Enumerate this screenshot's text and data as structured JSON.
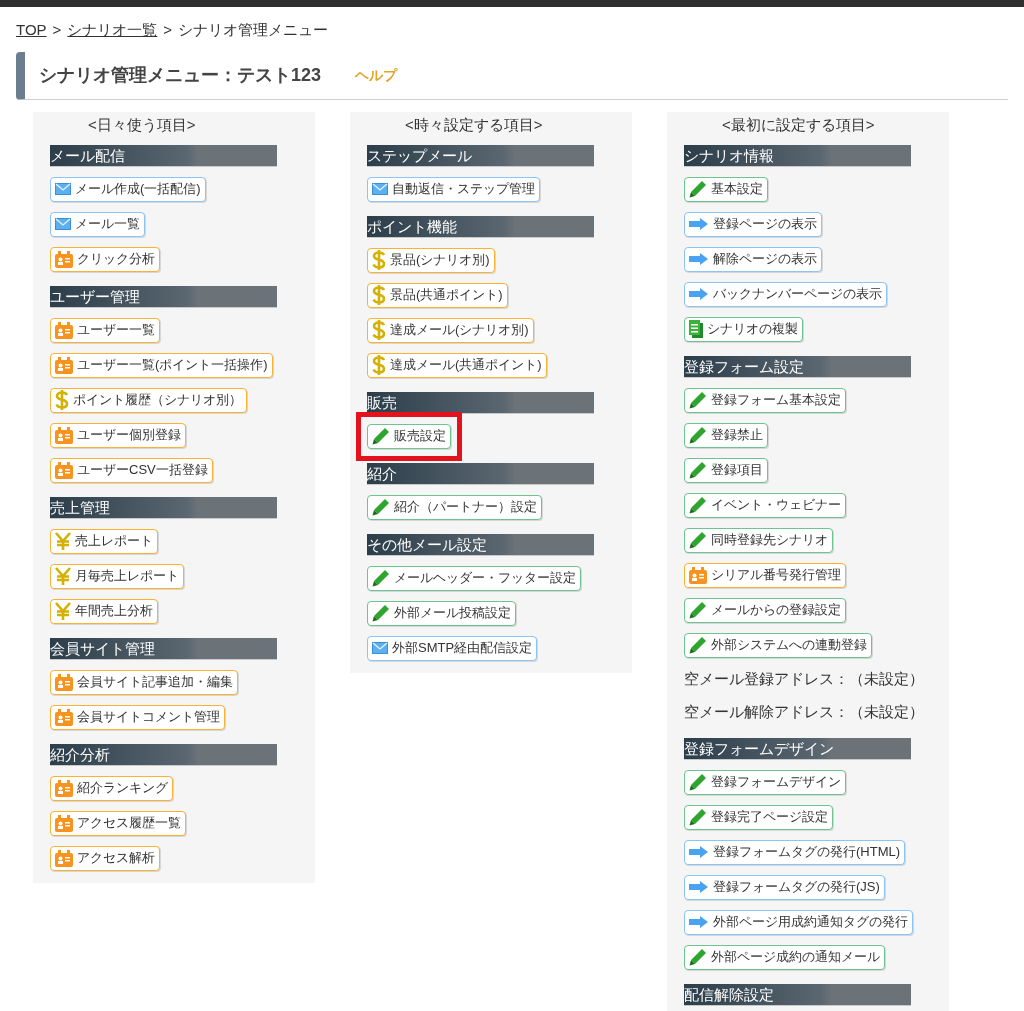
{
  "breadcrumb": [
    {
      "label": "TOP",
      "link": true
    },
    {
      "label": "シナリオ一覧",
      "link": true
    },
    {
      "label": "シナリオ管理メニュー",
      "link": false
    }
  ],
  "breadcrumb_separator": ">",
  "page_title": "シナリオ管理メニュー：テスト123",
  "help_link": "ヘルプ",
  "columns": [
    {
      "heading": "<日々使う項目>",
      "sections": [
        {
          "title": "メール配信",
          "items": [
            {
              "kind": "mail",
              "label": "メール作成(一括配信)",
              "highlighted": false
            },
            {
              "kind": "mail",
              "label": "メール一覧",
              "highlighted": false
            },
            {
              "kind": "user",
              "label": "クリック分析",
              "highlighted": false
            }
          ]
        },
        {
          "title": "ユーザー管理",
          "items": [
            {
              "kind": "user",
              "label": "ユーザー一覧",
              "highlighted": false
            },
            {
              "kind": "user",
              "label": "ユーザー一覧(ポイント一括操作)",
              "highlighted": false
            },
            {
              "kind": "dollar",
              "label": "ポイント履歴（シナリオ別）",
              "highlighted": false
            },
            {
              "kind": "user",
              "label": "ユーザー個別登録",
              "highlighted": false
            },
            {
              "kind": "user",
              "label": "ユーザーCSV一括登録",
              "highlighted": false
            }
          ]
        },
        {
          "title": "売上管理",
          "items": [
            {
              "kind": "yen",
              "label": "売上レポート",
              "highlighted": false
            },
            {
              "kind": "yen",
              "label": "月毎売上レポート",
              "highlighted": false
            },
            {
              "kind": "yen",
              "label": "年間売上分析",
              "highlighted": false
            }
          ]
        },
        {
          "title": "会員サイト管理",
          "items": [
            {
              "kind": "user",
              "label": "会員サイト記事追加・編集",
              "highlighted": false
            },
            {
              "kind": "user",
              "label": "会員サイトコメント管理",
              "highlighted": false
            }
          ]
        },
        {
          "title": "紹介分析",
          "items": [
            {
              "kind": "user",
              "label": "紹介ランキング",
              "highlighted": false
            },
            {
              "kind": "user",
              "label": "アクセス履歴一覧",
              "highlighted": false
            },
            {
              "kind": "user",
              "label": "アクセス解析",
              "highlighted": false
            }
          ]
        }
      ]
    },
    {
      "heading": "<時々設定する項目>",
      "sections": [
        {
          "title": "ステップメール",
          "items": [
            {
              "kind": "mail",
              "label": "自動返信・ステップ管理",
              "highlighted": false
            }
          ]
        },
        {
          "title": "ポイント機能",
          "items": [
            {
              "kind": "dollar",
              "label": "景品(シナリオ別)",
              "highlighted": false
            },
            {
              "kind": "dollar",
              "label": "景品(共通ポイント)",
              "highlighted": false
            },
            {
              "kind": "dollar",
              "label": "達成メール(シナリオ別)",
              "highlighted": false
            },
            {
              "kind": "dollar",
              "label": "達成メール(共通ポイント)",
              "highlighted": false
            }
          ]
        },
        {
          "title": "販売",
          "items": [
            {
              "kind": "pencil",
              "label": "販売設定",
              "highlighted": true
            }
          ]
        },
        {
          "title": "紹介",
          "items": [
            {
              "kind": "pencil",
              "label": "紹介（パートナー）設定",
              "highlighted": false
            }
          ]
        },
        {
          "title": "その他メール設定",
          "items": [
            {
              "kind": "pencil",
              "label": "メールヘッダー・フッター設定",
              "highlighted": false
            },
            {
              "kind": "pencil",
              "label": "外部メール投稿設定",
              "highlighted": false
            },
            {
              "kind": "mail",
              "label": "外部SMTP経由配信設定",
              "highlighted": false
            }
          ]
        }
      ]
    },
    {
      "heading": "<最初に設定する項目>",
      "sections": [
        {
          "title": "シナリオ情報",
          "items": [
            {
              "kind": "pencil",
              "label": "基本設定",
              "highlighted": false
            },
            {
              "kind": "arrow",
              "label": "登録ページの表示",
              "highlighted": false
            },
            {
              "kind": "arrow",
              "label": "解除ページの表示",
              "highlighted": false
            },
            {
              "kind": "arrow",
              "label": "バックナンバーページの表示",
              "highlighted": false
            },
            {
              "kind": "copy",
              "label": "シナリオの複製",
              "highlighted": false
            }
          ]
        },
        {
          "title": "登録フォーム設定",
          "items": [
            {
              "kind": "pencil",
              "label": "登録フォーム基本設定",
              "highlighted": false
            },
            {
              "kind": "pencil",
              "label": "登録禁止",
              "highlighted": false
            },
            {
              "kind": "pencil",
              "label": "登録項目",
              "highlighted": false
            },
            {
              "kind": "pencil",
              "label": "イベント・ウェビナー",
              "highlighted": false
            },
            {
              "kind": "pencil",
              "label": "同時登録先シナリオ",
              "highlighted": false
            },
            {
              "kind": "user",
              "label": "シリアル番号発行管理",
              "highlighted": false
            },
            {
              "kind": "pencil",
              "label": "メールからの登録設定",
              "highlighted": false
            },
            {
              "kind": "pencil",
              "label": "外部システムへの連動登録",
              "highlighted": false
            },
            {
              "kind": "text",
              "label": "空メール登録アドレス：（未設定）",
              "highlighted": false
            },
            {
              "kind": "text",
              "label": "空メール解除アドレス：（未設定）",
              "highlighted": false
            }
          ]
        },
        {
          "title": "登録フォームデザイン",
          "items": [
            {
              "kind": "pencil",
              "label": "登録フォームデザイン",
              "highlighted": false
            },
            {
              "kind": "pencil",
              "label": "登録完了ページ設定",
              "highlighted": false
            },
            {
              "kind": "arrow",
              "label": "登録フォームタグの発行(HTML)",
              "highlighted": false
            },
            {
              "kind": "arrow",
              "label": "登録フォームタグの発行(JS)",
              "highlighted": false
            },
            {
              "kind": "arrow",
              "label": "外部ページ用成約通知タグの発行",
              "highlighted": false
            },
            {
              "kind": "pencil",
              "label": "外部ページ成約の通知メール",
              "highlighted": false
            }
          ]
        },
        {
          "title": "配信解除設定"
        }
      ]
    }
  ]
}
